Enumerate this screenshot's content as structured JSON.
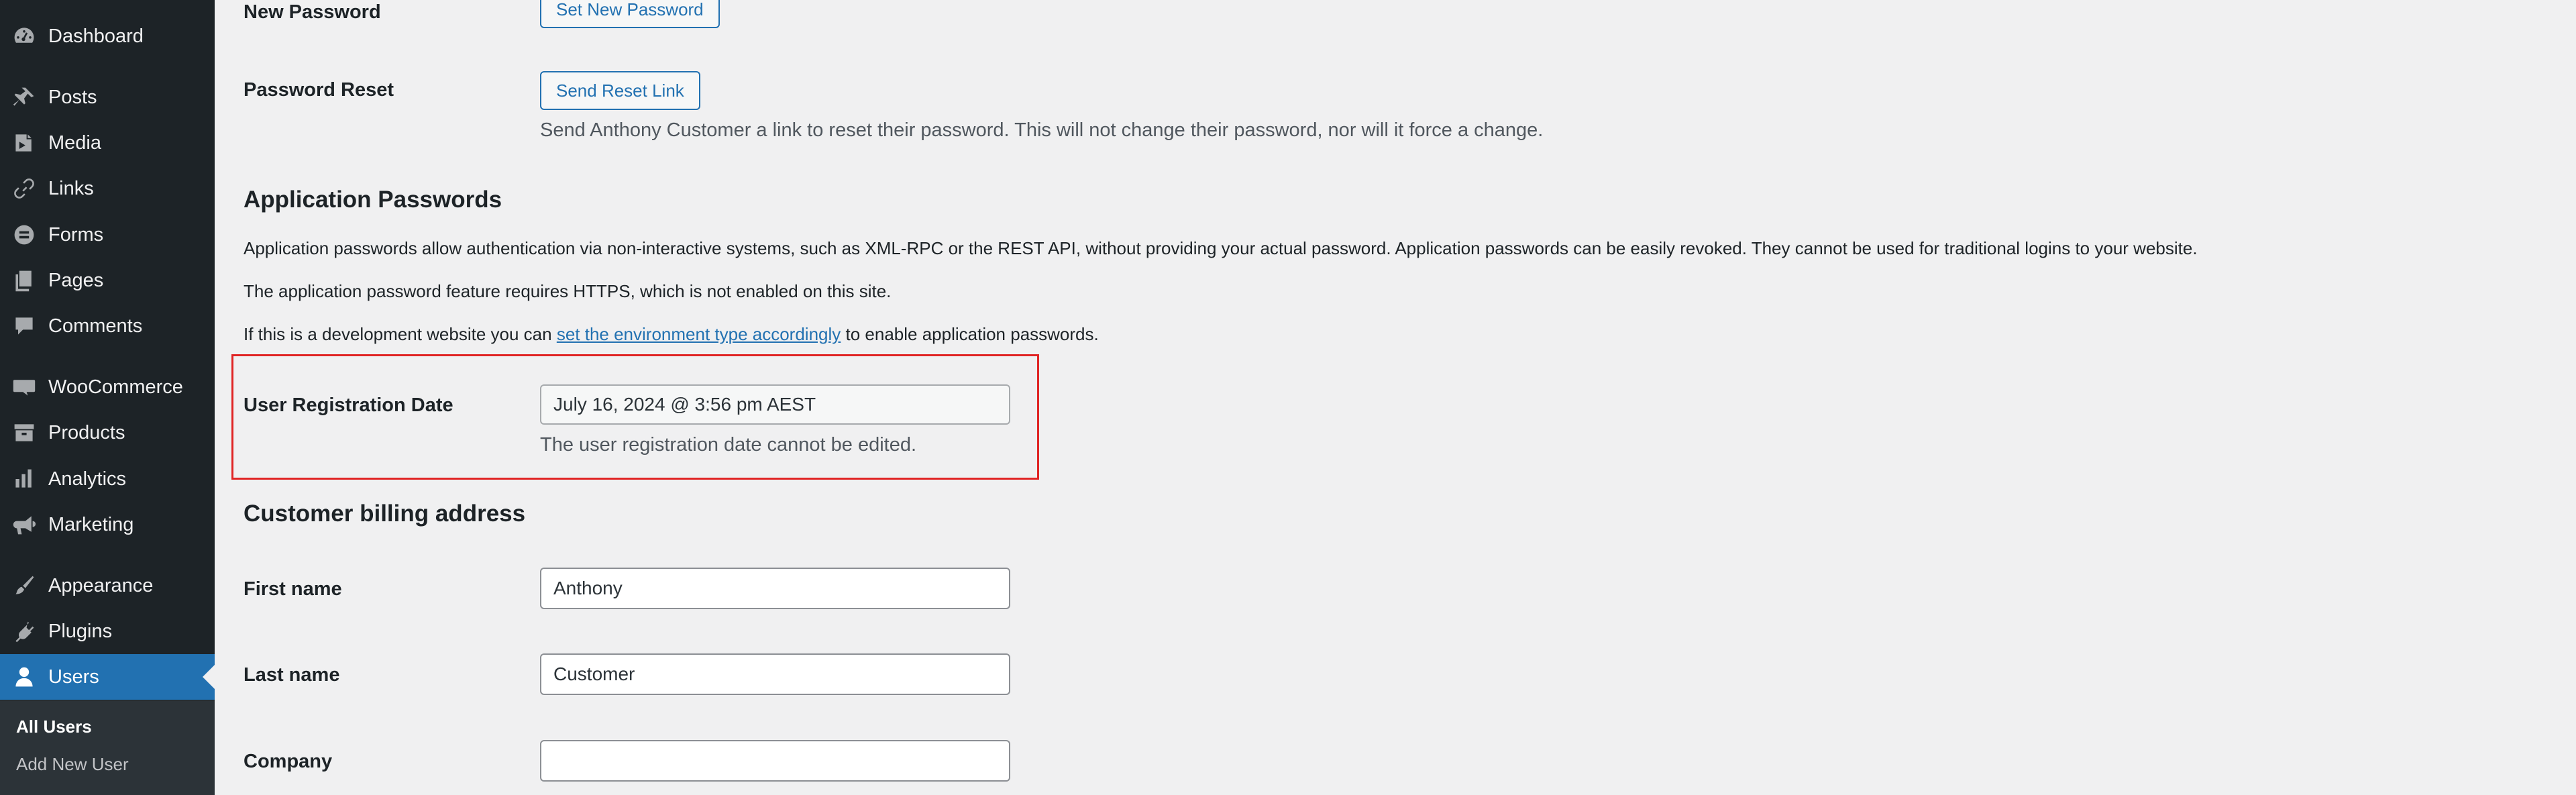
{
  "sidebar": {
    "items": [
      {
        "label": "Dashboard",
        "icon": "dashboard-icon"
      },
      {
        "label": "Posts",
        "icon": "pushpin-icon"
      },
      {
        "label": "Media",
        "icon": "media-icon"
      },
      {
        "label": "Links",
        "icon": "link-icon"
      },
      {
        "label": "Forms",
        "icon": "forms-icon"
      },
      {
        "label": "Pages",
        "icon": "pages-icon"
      },
      {
        "label": "Comments",
        "icon": "comment-icon"
      },
      {
        "label": "WooCommerce",
        "icon": "woo-icon"
      },
      {
        "label": "Products",
        "icon": "archive-icon"
      },
      {
        "label": "Analytics",
        "icon": "bar-chart-icon"
      },
      {
        "label": "Marketing",
        "icon": "megaphone-icon"
      },
      {
        "label": "Appearance",
        "icon": "paintbrush-icon"
      },
      {
        "label": "Plugins",
        "icon": "plug-icon"
      },
      {
        "label": "Users",
        "icon": "user-icon"
      }
    ],
    "submenu": {
      "all_users": "All Users",
      "add_new_user": "Add New User"
    }
  },
  "account": {
    "new_password_label": "New Password",
    "set_new_password_button": "Set New Password",
    "password_reset_label": "Password Reset",
    "send_reset_link_button": "Send Reset Link",
    "password_reset_description": "Send Anthony Customer a link to reset their password. This will not change their password, nor will it force a change."
  },
  "app_passwords": {
    "title": "Application Passwords",
    "description": "Application passwords allow authentication via non-interactive systems, such as XML-RPC or the REST API, without providing your actual password. Application passwords can be easily revoked. They cannot be used for traditional logins to your website.",
    "https_notice": "The application password feature requires HTTPS, which is not enabled on this site.",
    "dev_prefix": "If this is a development website you can ",
    "dev_link": "set the environment type accordingly",
    "dev_suffix": " to enable application passwords."
  },
  "registration": {
    "label": "User Registration Date",
    "value": "July 16, 2024 @ 3:56 pm AEST",
    "note": "The user registration date cannot be edited.",
    "highlight_color": "#e02424"
  },
  "billing": {
    "title": "Customer billing address",
    "first_name_label": "First name",
    "first_name_value": "Anthony",
    "last_name_label": "Last name",
    "last_name_value": "Customer",
    "company_label": "Company",
    "company_value": ""
  },
  "colors": {
    "sidebar_bg": "#1d2327",
    "accent": "#2271b1",
    "page_bg": "#f0f0f1"
  }
}
